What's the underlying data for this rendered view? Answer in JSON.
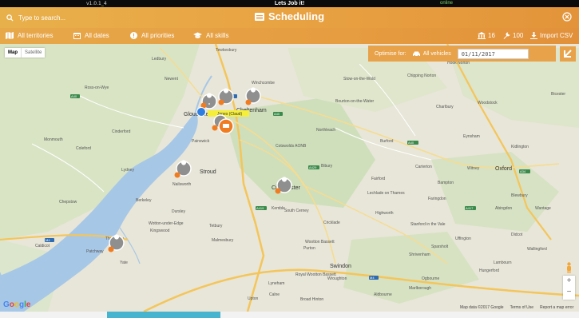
{
  "appbar": {
    "version": "v1.0.1_4",
    "title": "Lets Job it!",
    "status": "online"
  },
  "header": {
    "search_placeholder": "Type to search...",
    "title": "Scheduling"
  },
  "filters": {
    "territories": "All territories",
    "dates": "All dates",
    "priorities": "All priorities",
    "skills": "All skills",
    "count_a": "16",
    "count_b": "100",
    "import": "Import CSV"
  },
  "map": {
    "type_map": "Map",
    "type_satellite": "Satellite",
    "optimise_label": "Optimise for:",
    "vehicles": "All vehicles",
    "date": "01/11/2017",
    "job_label": "Jones (Claud)",
    "attribution": [
      "Map data ©2017 Google",
      "Terms of Use",
      "Report a map error"
    ],
    "google": "Google",
    "places_major": [
      "Cheltenham",
      "Gloucester",
      "Stroud",
      "Cirencester",
      "Swindon",
      "Oxford",
      "Cotswolds AONB"
    ],
    "places_minor": [
      "Tewkesbury",
      "Ross-on-Wye",
      "Monmouth",
      "Coleford",
      "Cinderford",
      "Lydney",
      "Chepstow",
      "Caldicot",
      "Thornbury",
      "Dursley",
      "Berkeley",
      "Northleach",
      "Burford",
      "Witney",
      "Abingdon",
      "Faringdon",
      "Malmesbury",
      "Kemble",
      "Tetbury",
      "Wootton Bassett",
      "Wroughton",
      "Marlborough",
      "Highworth",
      "Lechlade on Thames",
      "Bibury",
      "Woodstock",
      "Bicester",
      "Winchcombe",
      "Painswick",
      "Nailsworth",
      "Wantage",
      "Didcot",
      "Wallingford",
      "Hungerford",
      "Ledbury",
      "Newent",
      "Fairford",
      "Carterton",
      "Bampton",
      "Kidlington",
      "Stow-on-the-Wold",
      "Chipping Norton",
      "Hook Norton",
      "Charlbury",
      "Yate",
      "Patchway",
      "Calne",
      "Royal Wootton Bassett",
      "Purton",
      "Cricklade",
      "South Cerney",
      "Wotton-under-Edge",
      "Kingswood",
      "Upton",
      "Bourton-on-the-Water",
      "Eynsham",
      "Blewbury",
      "Lambourn",
      "Shrivenham",
      "Lyneham",
      "Broad Hinton",
      "Aldbourne",
      "Ogbourne",
      "Sparsholt",
      "Uffington",
      "Stanford in the Vale"
    ]
  },
  "colors": {
    "accent": "#e8a24a",
    "marker_grey": "#8f8f8f",
    "marker_orange": "#f07c22",
    "water": "#a7c7e7"
  }
}
